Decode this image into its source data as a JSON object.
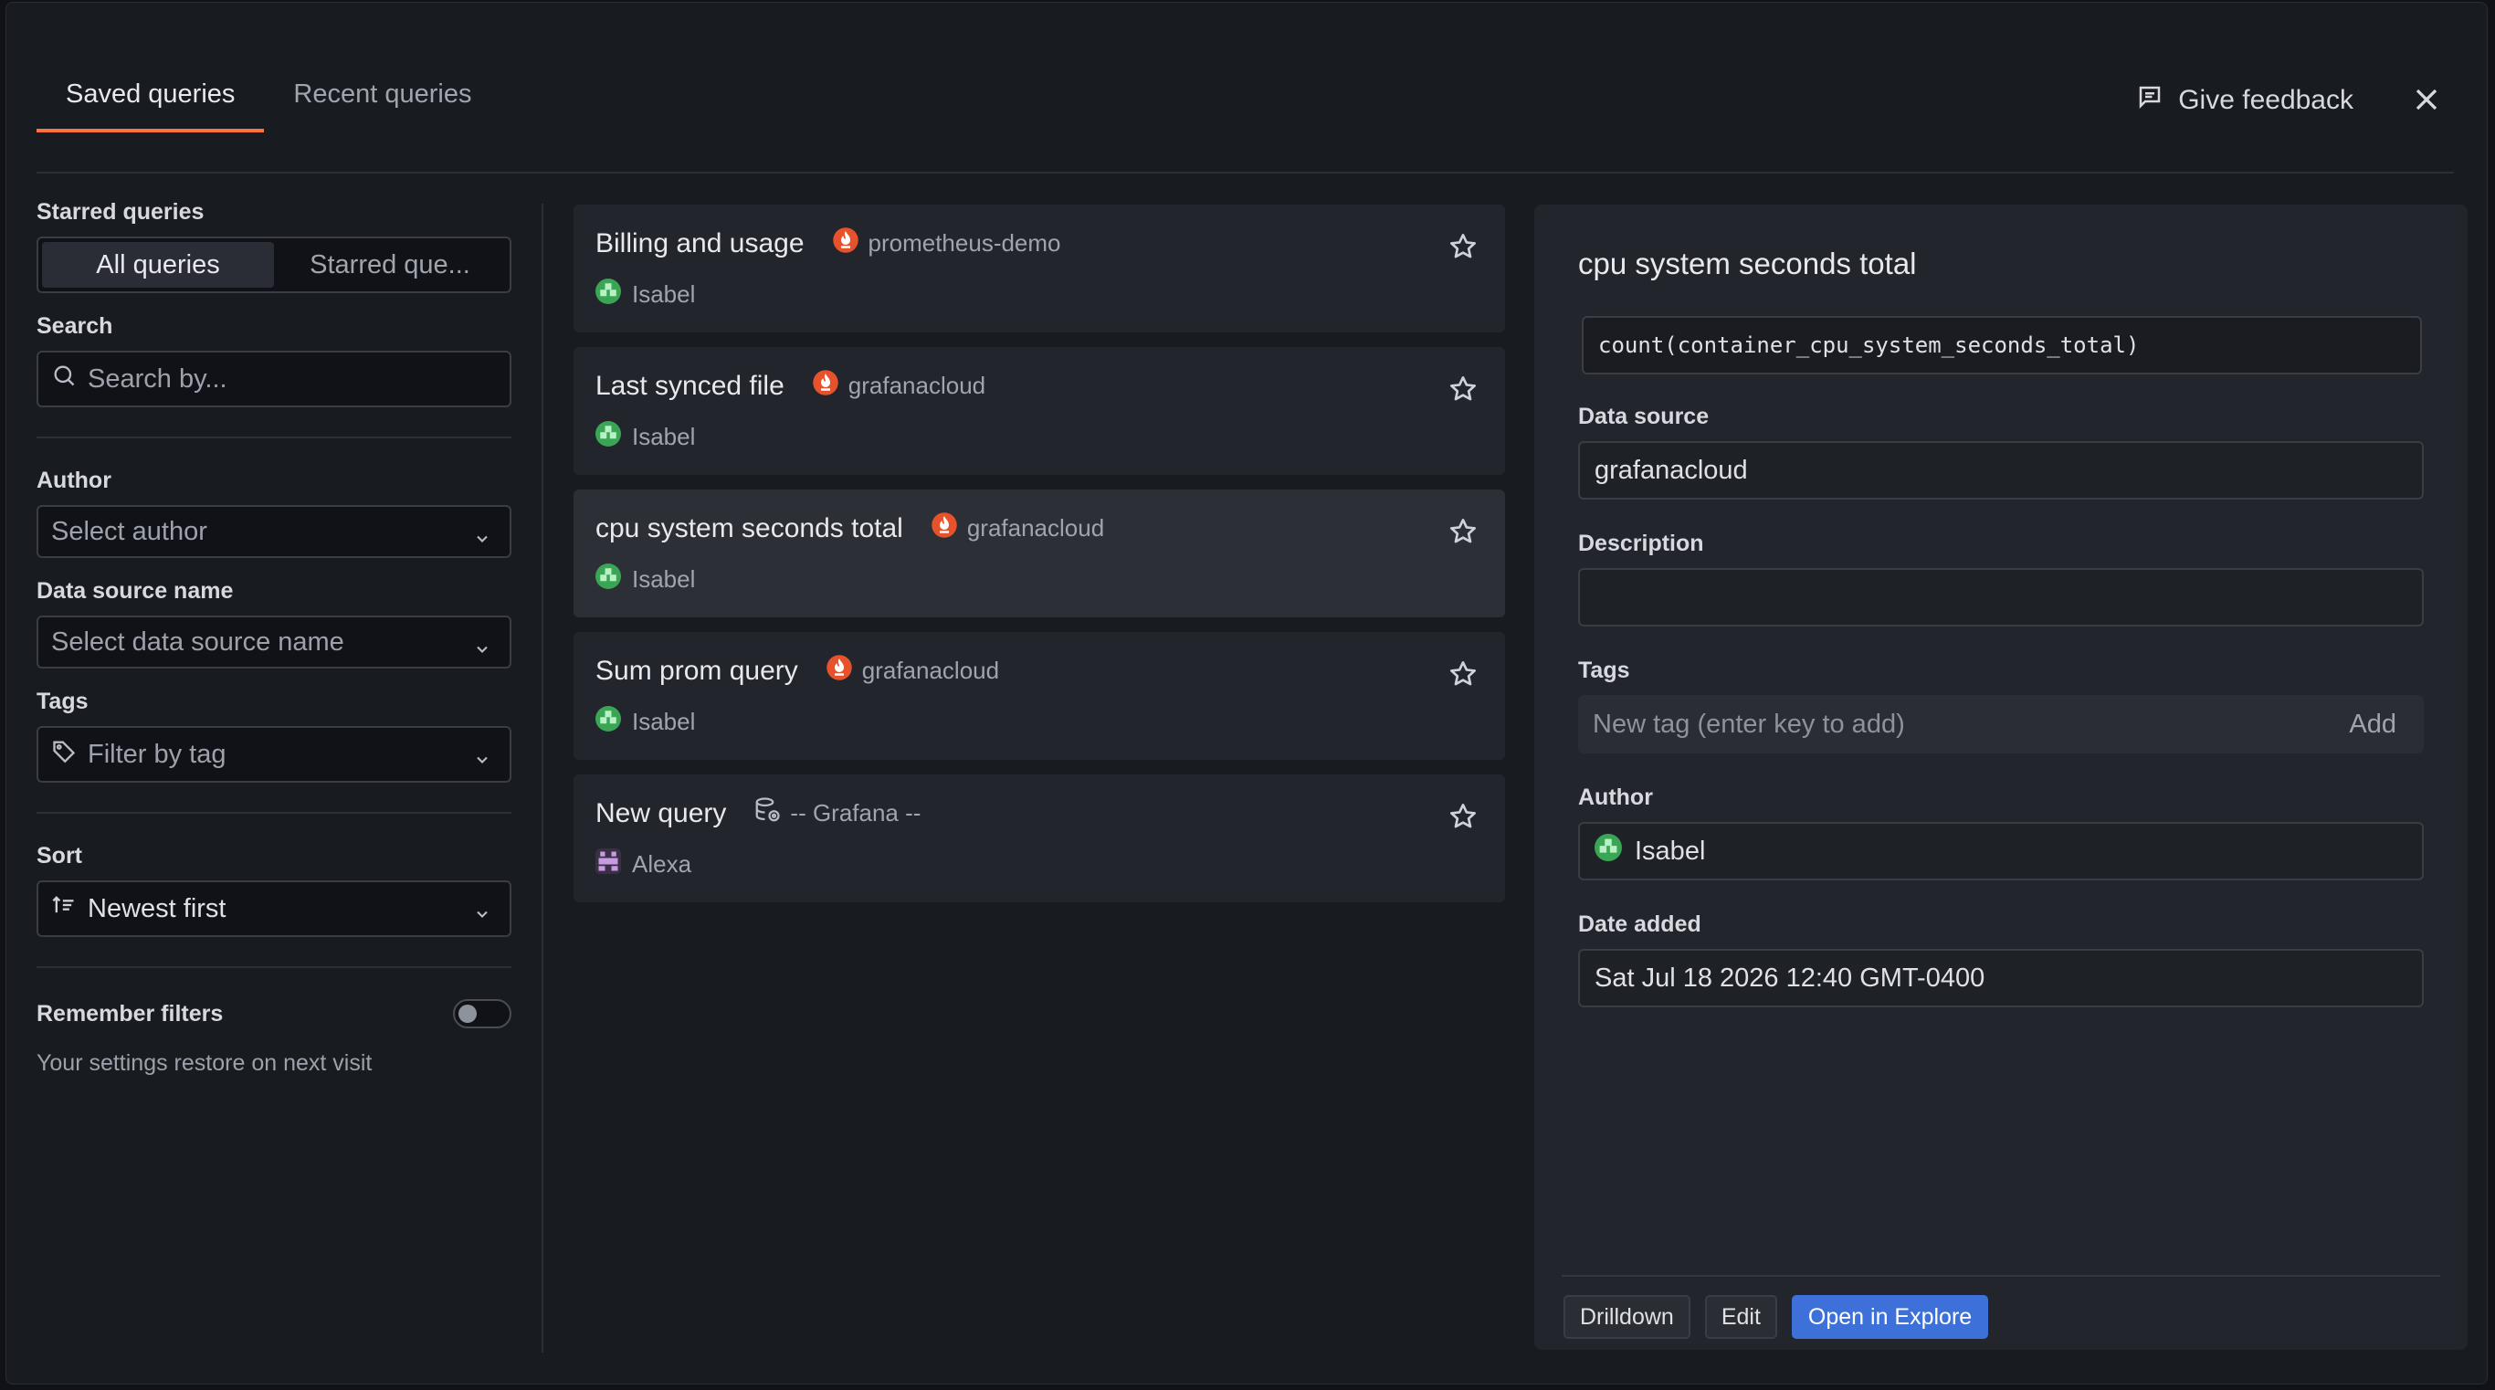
{
  "tabs": [
    {
      "label": "Saved queries",
      "active": true
    },
    {
      "label": "Recent queries",
      "active": false
    }
  ],
  "header": {
    "feedback_label": "Give feedback"
  },
  "filters": {
    "starred_label": "Starred queries",
    "segments": [
      "All queries",
      "Starred que..."
    ],
    "search_label": "Search",
    "search_placeholder": "Search by...",
    "author_label": "Author",
    "author_placeholder": "Select author",
    "datasource_label": "Data source name",
    "datasource_placeholder": "Select data source name",
    "tags_label": "Tags",
    "tags_placeholder": "Filter by tag",
    "sort_label": "Sort",
    "sort_value": "Newest first",
    "remember_label": "Remember filters",
    "remember_hint": "Your settings restore on next visit"
  },
  "queries": [
    {
      "title": "Billing and usage",
      "datasource": "prometheus-demo",
      "ds_icon": "prometheus-icon",
      "author": "Isabel",
      "avatar": "green"
    },
    {
      "title": "Last synced file",
      "datasource": "grafanacloud",
      "ds_icon": "prometheus-icon",
      "author": "Isabel",
      "avatar": "green"
    },
    {
      "title": "cpu system seconds total",
      "datasource": "grafanacloud",
      "ds_icon": "prometheus-icon",
      "author": "Isabel",
      "avatar": "green",
      "selected": true
    },
    {
      "title": "Sum prom query",
      "datasource": "grafanacloud",
      "ds_icon": "prometheus-icon",
      "author": "Isabel",
      "avatar": "green"
    },
    {
      "title": "New query",
      "datasource": "-- Grafana --",
      "ds_icon": "database-icon",
      "author": "Alexa",
      "avatar": "purple"
    }
  ],
  "details": {
    "title": "cpu system seconds total",
    "query": "count(container_cpu_system_seconds_total)",
    "datasource_label": "Data source",
    "datasource": "grafanacloud",
    "description_label": "Description",
    "description": "",
    "tags_label": "Tags",
    "tags_placeholder": "New tag (enter key to add)",
    "tags_add": "Add",
    "author_label": "Author",
    "author": "Isabel",
    "date_label": "Date added",
    "date": "Sat Jul 18 2026 12:40 GMT-0400",
    "actions": {
      "drilldown": "Drilldown",
      "edit": "Edit",
      "explore": "Open in Explore"
    }
  },
  "colors": {
    "accent": "#ff7340",
    "primary": "#3d71d9",
    "prometheus": "#e6522c"
  }
}
